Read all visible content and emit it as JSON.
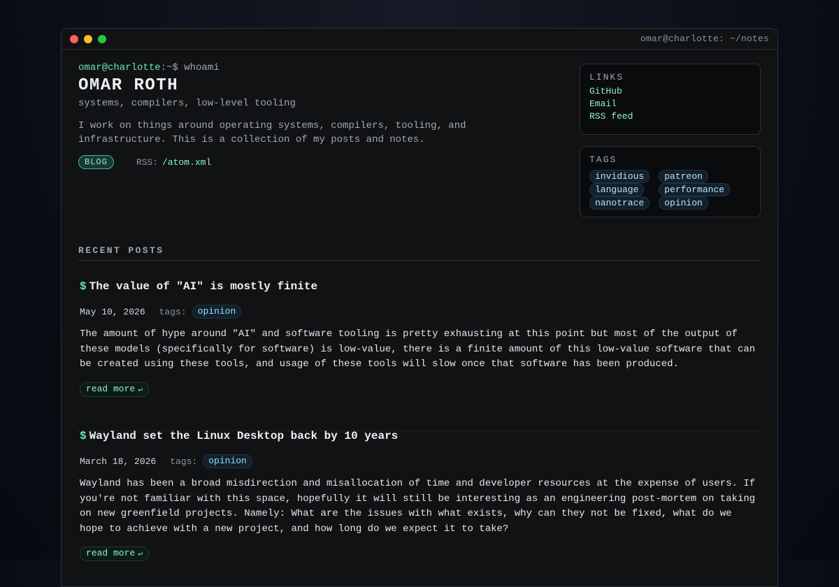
{
  "window": {
    "title": "omar@charlotte: ~/notes"
  },
  "hero": {
    "prompt_user": "omar@charlotte",
    "prompt_rest": ":~$ whoami",
    "name": "OMAR ROTH",
    "subtitle": "systems, compilers, low-level tooling",
    "bio": "I work on things around operating systems, compilers, tooling, and infrastructure. This is a collection of my posts and notes.",
    "badge": "BLOG",
    "rss_label": "RSS:",
    "rss_link": "/atom.xml"
  },
  "links": {
    "title": "LINKS",
    "items": [
      "GitHub",
      "Email",
      "RSS feed"
    ]
  },
  "tags": {
    "title": "TAGS",
    "items": [
      "invidious",
      "patreon",
      "language",
      "performance",
      "nanotrace",
      "opinion"
    ]
  },
  "recent": {
    "header": "RECENT POSTS",
    "posts": [
      {
        "prompt": "$",
        "title": "The value of \"AI\" is mostly finite",
        "date": "May 10, 2026",
        "tags_label": "tags:",
        "tag": "opinion",
        "body": "The amount of hype around \"AI\" and software tooling is pretty exhausting at this point but most of the output of these models (specifically for software) is low-value, there is a finite amount of this low-value software that can be created using these tools, and usage of these tools will slow once that software has been produced.",
        "read_more": "read more",
        "read_more_glyph": "↵"
      },
      {
        "prompt": "$",
        "title": "Wayland set the Linux Desktop back by 10 years",
        "date": "March 18, 2026",
        "tags_label": "tags:",
        "tag": "opinion",
        "body": "Wayland has been a broad misdirection and misallocation of time and developer resources at the expense of users. If you're not familiar with this space, hopefully it will still be interesting as an engineering post-mortem on taking on new greenfield projects. Namely: What are the issues with what exists, why can they not be fixed, what do we hope to achieve with a new project, and how long do we expect it to take?",
        "read_more": "read more",
        "read_more_glyph": "↵"
      }
    ]
  }
}
